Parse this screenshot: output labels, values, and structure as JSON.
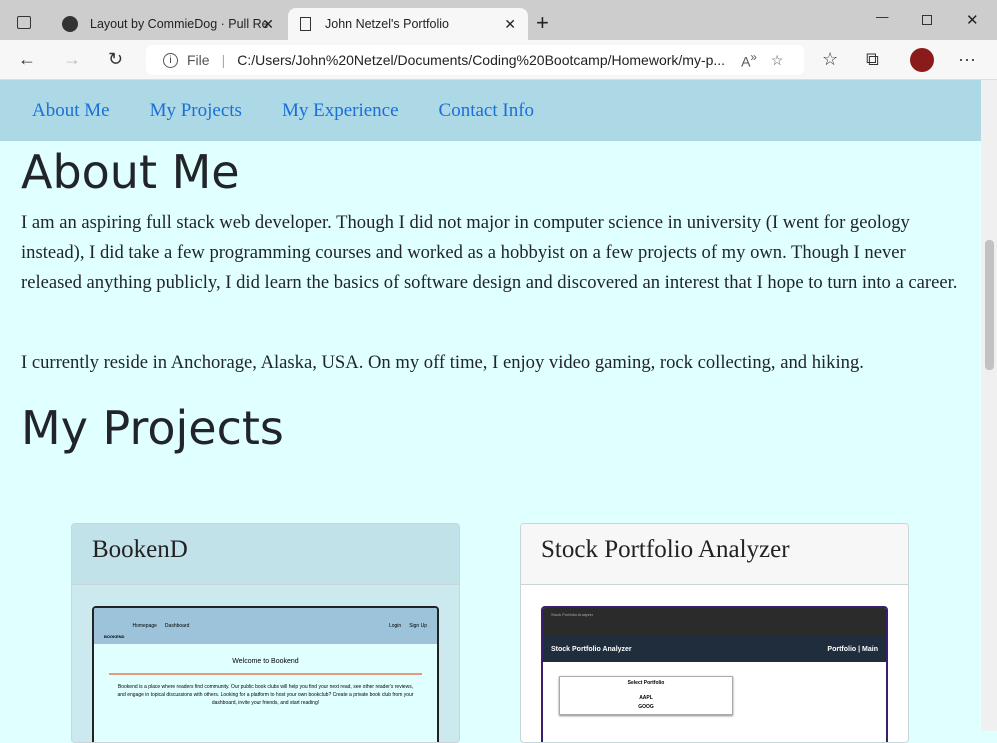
{
  "browser": {
    "tabs": [
      {
        "title": "Layout by CommieDog · Pull Req",
        "icon": "github-icon"
      },
      {
        "title": "John Netzel's Portfolio",
        "icon": "page-icon"
      }
    ],
    "address_prefix": "File",
    "url": "C:/Users/John%20Netzel/Documents/Coding%20Bootcamp/Homework/my-p..."
  },
  "nav": [
    "About Me",
    "My Projects",
    "My Experience",
    "Contact Info"
  ],
  "about": {
    "heading": "About Me",
    "p1": "I am an aspiring full stack web developer. Though I did not major in computer science in university (I went for geology instead), I did take a few programming courses and worked as a hobbyist on a few projects of my own. Though I never released anything publicly, I did learn the basics of software design and discovered an interest that I hope to turn into a career.",
    "p2": "I currently reside in Anchorage, Alaska, USA. On my off time, I enjoy video gaming, rock collecting, and hiking."
  },
  "projects": {
    "heading": "My Projects",
    "cards": [
      {
        "title": "BookenD",
        "shot": {
          "logo": "BOOKEND",
          "links": [
            "Homepage",
            "Dashboard"
          ],
          "right": [
            "Login",
            "Sign Up"
          ],
          "welcome": "Welcome to Bookend",
          "text": "Bookend is a place where readers find community. Our public book clubs will help you find your next read, see other reader's reviews, and engage in topical discussions with others. Looking for a platform to host your own bookclub? Create a private book club from your dashboard, invite your friends, and start reading!"
        }
      },
      {
        "title": "Stock Portfolio Analyzer",
        "shot": {
          "tab": "Stock Portfolio Analyzer",
          "brand": "Stock Portfolio Analyzer",
          "right": "Portfolio | Main",
          "box_title": "Select Portfolio",
          "items": [
            "AAPL",
            "GOOG"
          ]
        }
      }
    ]
  }
}
